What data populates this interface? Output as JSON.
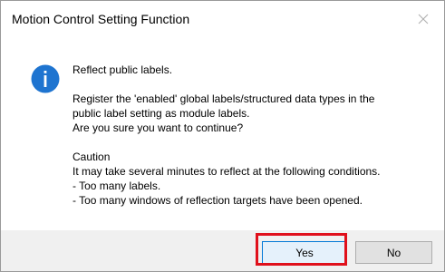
{
  "window": {
    "title": "Motion Control Setting Function",
    "close_icon": "close-icon"
  },
  "icon": {
    "name": "info-icon",
    "color": "#1e74d0"
  },
  "message": {
    "line1": "Reflect public labels.",
    "line2": "Register the 'enabled' global labels/structured data types in the",
    "line3": "public label setting as module labels.",
    "line4": "Are you sure you want to continue?",
    "line5": "Caution",
    "line6": "It may take several minutes to reflect at the following conditions.",
    "line7": "- Too many labels.",
    "line8": "- Too many windows of reflection targets have been opened."
  },
  "buttons": {
    "yes_label": "Yes",
    "no_label": "No"
  },
  "colors": {
    "highlight": "#e0101b",
    "default_button_border": "#0078d7"
  }
}
